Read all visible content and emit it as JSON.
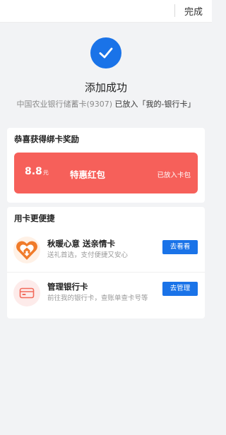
{
  "topbar": {
    "done_label": "完成"
  },
  "success": {
    "title": "添加成功",
    "bank_info": "中国农业银行储蓄卡(9307)",
    "placed_in": "已放入「我的-银行卡」"
  },
  "reward": {
    "section_title": "恭喜获得绑卡奖励",
    "amount": "8.8",
    "unit": "元",
    "name": "特惠红包",
    "status": "已放入卡包"
  },
  "quick_services": {
    "section_title": "用卡更便捷",
    "items": [
      {
        "icon": "heart-house-icon",
        "name": "秋暖心意 送亲情卡",
        "desc": "送礼首选，支付便捷又安心",
        "button": "去看看"
      },
      {
        "icon": "bank-card-icon",
        "name": "管理银行卡",
        "desc": "前往我的银行卡，查账单查卡号等",
        "button": "去管理"
      }
    ]
  },
  "colors": {
    "accent": "#1a73e8",
    "reward_red": "#f6605a",
    "background": "#f2f3f5"
  }
}
